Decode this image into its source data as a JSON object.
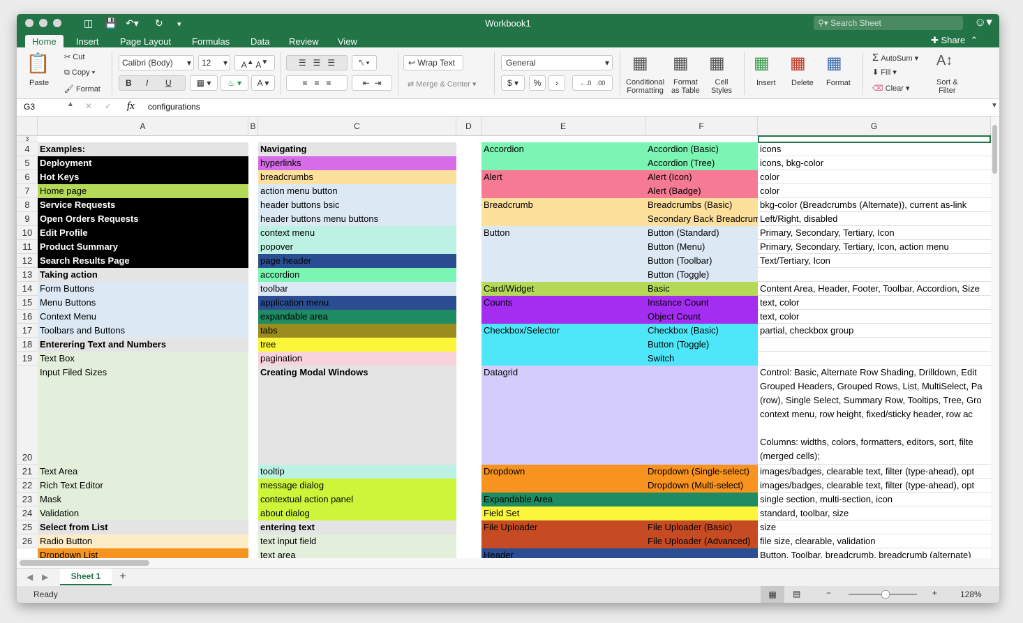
{
  "window": {
    "title": "Workbook1",
    "search_placeholder": "Search Sheet",
    "share_label": "Share"
  },
  "tabs": [
    "Home",
    "Insert",
    "Page Layout",
    "Formulas",
    "Data",
    "Review",
    "View"
  ],
  "ribbon": {
    "paste": "Paste",
    "cut": "Cut",
    "copy": "Copy",
    "format_painter": "Format",
    "font_name": "Calibri (Body)",
    "font_size": "12",
    "bold": "B",
    "italic": "I",
    "underline": "U",
    "wrap_text": "Wrap Text",
    "merge_center": "Merge & Center",
    "number_format": "General",
    "currency": "$",
    "percent": "%",
    "comma": "›",
    "increase_decimal": "←.0\n.00",
    "decrease_decimal": ".00\n→.0",
    "conditional_formatting": "Conditional\nFormatting",
    "format_as_table": "Format\nas Table",
    "cell_styles": "Cell\nStyles",
    "insert": "Insert",
    "delete": "Delete",
    "format": "Format",
    "autosum": "AutoSum",
    "fill": "Fill",
    "clear": "Clear",
    "sort_filter": "Sort &\nFilter"
  },
  "formula_bar": {
    "cell_ref": "G3",
    "fx": "fx",
    "content": "configurations"
  },
  "column_headers": [
    "A",
    "B",
    "C",
    "D",
    "E",
    "F",
    "G"
  ],
  "row_headers": [
    "3",
    "4",
    "5",
    "6",
    "7",
    "8",
    "9",
    "10",
    "11",
    "12",
    "13",
    "14",
    "15",
    "16",
    "17",
    "18",
    "19",
    "20",
    "21",
    "22",
    "23",
    "24",
    "25",
    "26"
  ],
  "cells": {
    "A": [
      {
        "row": 4,
        "text": "Examples:",
        "bold": true,
        "bg": "#e4e4e4"
      },
      {
        "row": 5,
        "text": "Deployment",
        "bold": true,
        "bg": "#000000",
        "color": "#ffffff"
      },
      {
        "row": 6,
        "text": "Hot Keys",
        "bold": true,
        "bg": "#000000",
        "color": "#ffffff"
      },
      {
        "row": 7,
        "text": "Home page",
        "bg": "#b3d957"
      },
      {
        "row": 8,
        "text": "Service Requests",
        "bold": true,
        "bg": "#000000",
        "color": "#ffffff"
      },
      {
        "row": 9,
        "text": "Open Orders Requests",
        "bold": true,
        "bg": "#000000",
        "color": "#ffffff"
      },
      {
        "row": 10,
        "text": "Edit Profile",
        "bold": true,
        "bg": "#000000",
        "color": "#ffffff"
      },
      {
        "row": 11,
        "text": "Product Summary",
        "bold": true,
        "bg": "#000000",
        "color": "#ffffff"
      },
      {
        "row": 12,
        "text": "Search Results Page",
        "bold": true,
        "bg": "#000000",
        "color": "#ffffff"
      },
      {
        "row": 13,
        "text": "Taking action",
        "bold": true,
        "bg": "#e4e4e4"
      },
      {
        "row": 14,
        "text": "Form Buttons",
        "bg": "#dce9f5"
      },
      {
        "row": 15,
        "text": "Menu Buttons",
        "bg": "#dce9f5"
      },
      {
        "row": 16,
        "text": "Context Menu",
        "bg": "#dce9f5"
      },
      {
        "row": 17,
        "text": "Toolbars and Buttons",
        "bg": "#dce9f5"
      },
      {
        "row": 18,
        "text": "Enterering Text and Numbers",
        "bold": true,
        "bg": "#e4e4e4"
      },
      {
        "row": 19,
        "text": "Text Box",
        "bg": "#e3efdb"
      },
      {
        "row": 20,
        "text": "Input Filed Sizes",
        "bg": "#e3efdb"
      },
      {
        "row": 21,
        "text": "Text Area",
        "bg": "#e3efdb"
      },
      {
        "row": 22,
        "text": "Rich Text Editor",
        "bg": "#e3efdb"
      },
      {
        "row": 23,
        "text": "Mask",
        "bg": "#e3efdb"
      },
      {
        "row": 24,
        "text": "Validation",
        "bg": "#e3efdb"
      },
      {
        "row": 25,
        "text": "Select from List",
        "bold": true,
        "bg": "#e4e4e4"
      },
      {
        "row": 26,
        "text": "Radio Button",
        "bg": "#fdecc8"
      },
      {
        "row": 27,
        "text": "Dropdown List",
        "bg": "#f7931e"
      }
    ],
    "C": [
      {
        "row": 4,
        "text": "Navigating",
        "bold": true,
        "bg": "#e4e4e4"
      },
      {
        "row": 5,
        "text": "hyperlinks",
        "bg": "#d76ce8"
      },
      {
        "row": 6,
        "text": "breadcrumbs",
        "bg": "#fde09c"
      },
      {
        "row": 7,
        "text": "action menu button",
        "bg": "#dce9f5"
      },
      {
        "row": 8,
        "text": "header buttons bsic",
        "bg": "#dce9f5"
      },
      {
        "row": 9,
        "text": "header buttons menu buttons",
        "bg": "#dce9f5"
      },
      {
        "row": 10,
        "text": "context menu",
        "bg": "#bdf1e4"
      },
      {
        "row": 11,
        "text": "popover",
        "bg": "#bdf1e4"
      },
      {
        "row": 12,
        "text": "page header",
        "bg": "#2b4e93"
      },
      {
        "row": 13,
        "text": "accordion",
        "bg": "#7bf5b3"
      },
      {
        "row": 14,
        "text": "toolbar",
        "bg": "#dce9f5"
      },
      {
        "row": 15,
        "text": "application menu",
        "bg": "#2b4e93"
      },
      {
        "row": 16,
        "text": "expandable area",
        "bg": "#1e8b62"
      },
      {
        "row": 17,
        "text": "tabs",
        "bg": "#9a8c1e"
      },
      {
        "row": 18,
        "text": "tree",
        "bg": "#fbf63a"
      },
      {
        "row": 19,
        "text": "pagination",
        "bg": "#f9d3dc"
      },
      {
        "row": 20,
        "text": "Creating Modal Windows",
        "bold": true,
        "bg": "#e4e4e4"
      },
      {
        "row": 21,
        "text": "tooltip",
        "bg": "#bdf1e4"
      },
      {
        "row": 22,
        "text": "message dialog",
        "bg": "#cdf53a"
      },
      {
        "row": 23,
        "text": "contextual action panel",
        "bg": "#cdf53a"
      },
      {
        "row": 24,
        "text": "about dialog",
        "bg": "#cdf53a"
      },
      {
        "row": 25,
        "text": "entering text",
        "bold": true,
        "bg": "#e4e4e4"
      },
      {
        "row": 26,
        "text": "text input field",
        "bg": "#e3efdb"
      },
      {
        "row": 27,
        "text": "text area",
        "bg": "#e3efdb"
      }
    ],
    "E": [
      {
        "row": 4,
        "text": "Accordion",
        "bg": "#7bf5b3",
        "span": 2
      },
      {
        "row": 6,
        "text": "Alert",
        "bg": "#f67a93",
        "span": 2
      },
      {
        "row": 8,
        "text": "Breadcrumb",
        "bg": "#fde09c",
        "span": 2
      },
      {
        "row": 10,
        "text": "Button",
        "bg": "#dce9f5",
        "span": 4
      },
      {
        "row": 14,
        "text": "Card/Widget",
        "bg": "#b3d957",
        "span": 1
      },
      {
        "row": 15,
        "text": "Counts",
        "bg": "#a42df2",
        "span": 2
      },
      {
        "row": 17,
        "text": "Checkbox/Selector",
        "bg": "#4ee7f9",
        "span": 3
      },
      {
        "row": 20,
        "text": "Datagrid",
        "bg": "#d4ccfb",
        "span": 1
      },
      {
        "row": 21,
        "text": "Dropdown",
        "bg": "#f7931e",
        "span": 2
      },
      {
        "row": 23,
        "text": "Expandable Area",
        "bg": "#1e8b62",
        "span": 1
      },
      {
        "row": 24,
        "text": "Field Set",
        "bg": "#fbf63a",
        "span": 1
      },
      {
        "row": 25,
        "text": "File Uploader",
        "bg": "#c74b22",
        "span": 2
      },
      {
        "row": 27,
        "text": "Header",
        "bg": "#2b4e93",
        "span": 1
      }
    ],
    "F": [
      {
        "row": 4,
        "text": "Accordion (Basic)",
        "bg": "#7bf5b3"
      },
      {
        "row": 5,
        "text": "Accordion (Tree)",
        "bg": "#7bf5b3"
      },
      {
        "row": 6,
        "text": "Alert (Icon)",
        "bg": "#f67a93"
      },
      {
        "row": 7,
        "text": "Alert (Badge)",
        "bg": "#f67a93"
      },
      {
        "row": 8,
        "text": "Breadcrumbs (Basic)",
        "bg": "#fde09c"
      },
      {
        "row": 9,
        "text": "Secondary Back Breadcrumb",
        "bg": "#fde09c"
      },
      {
        "row": 10,
        "text": "Button (Standard)",
        "bg": "#dce9f5"
      },
      {
        "row": 11,
        "text": "Button (Menu)",
        "bg": "#dce9f5"
      },
      {
        "row": 12,
        "text": "Button (Toolbar)",
        "bg": "#dce9f5"
      },
      {
        "row": 13,
        "text": "Button (Toggle)",
        "bg": "#dce9f5"
      },
      {
        "row": 14,
        "text": "Basic",
        "bg": "#b3d957"
      },
      {
        "row": 15,
        "text": "Instance Count",
        "bg": "#a42df2"
      },
      {
        "row": 16,
        "text": "Object Count",
        "bg": "#a42df2"
      },
      {
        "row": 17,
        "text": "Checkbox (Basic)",
        "bg": "#4ee7f9"
      },
      {
        "row": 18,
        "text": "Button (Toggle)",
        "bg": "#4ee7f9"
      },
      {
        "row": 19,
        "text": "Switch",
        "bg": "#4ee7f9"
      },
      {
        "row": 20,
        "text": "",
        "bg": "#d4ccfb"
      },
      {
        "row": 21,
        "text": "Dropdown (Single-select)",
        "bg": "#f7931e"
      },
      {
        "row": 22,
        "text": "Dropdown (Multi-select)",
        "bg": "#f7931e"
      },
      {
        "row": 23,
        "text": "",
        "bg": "#1e8b62"
      },
      {
        "row": 24,
        "text": "",
        "bg": "#fbf63a"
      },
      {
        "row": 25,
        "text": "File Uploader (Basic)",
        "bg": "#c74b22"
      },
      {
        "row": 26,
        "text": "File Uploader (Advanced)",
        "bg": "#c74b22"
      },
      {
        "row": 27,
        "text": "",
        "bg": "#2b4e93"
      }
    ],
    "G": [
      {
        "row": 4,
        "text": "icons"
      },
      {
        "row": 5,
        "text": "icons, bkg-color"
      },
      {
        "row": 6,
        "text": "color"
      },
      {
        "row": 7,
        "text": "color"
      },
      {
        "row": 8,
        "text": "bkg-color (Breadcrumbs (Alternate)), current as-link"
      },
      {
        "row": 9,
        "text": "Left/Right, disabled"
      },
      {
        "row": 10,
        "text": "Primary, Secondary, Tertiary, Icon"
      },
      {
        "row": 11,
        "text": "Primary, Secondary, Tertiary, Icon, action menu"
      },
      {
        "row": 12,
        "text": "Text/Tertiary, Icon"
      },
      {
        "row": 13,
        "text": ""
      },
      {
        "row": 14,
        "text": "Content Area, Header, Footer, Toolbar, Accordion, Size"
      },
      {
        "row": 15,
        "text": "text, color"
      },
      {
        "row": 16,
        "text": "text, color"
      },
      {
        "row": 17,
        "text": "partial, checkbox group"
      },
      {
        "row": 18,
        "text": ""
      },
      {
        "row": 19,
        "text": ""
      },
      {
        "row": 20,
        "lines": [
          "Control: Basic, Alternate Row Shading, Drilldown, Edit",
          "Grouped Headers, Grouped Rows, List, MultiSelect, Pa",
          "(row), Single Select, Summary Row, Tooltips, Tree, Gro",
          "context menu, row height, fixed/sticky header, row ac",
          "",
          "Columns: widths, colors, formatters, editors, sort, filte",
          "(merged cells);"
        ]
      },
      {
        "row": 21,
        "text": "images/badges, clearable text, filter (type-ahead), opt"
      },
      {
        "row": 22,
        "text": "images/badges, clearable text, filter (type-ahead), opt"
      },
      {
        "row": 23,
        "text": "single section, multi-section, icon"
      },
      {
        "row": 24,
        "text": "standard, toolbar, size"
      },
      {
        "row": 25,
        "text": "size"
      },
      {
        "row": 26,
        "text": "file size, clearable, validation"
      },
      {
        "row": 27,
        "text": "Button, Toolbar, breadcrumb, breadcrumb (alternate)"
      }
    ]
  },
  "sheet_tabs": [
    "Sheet 1"
  ],
  "status": {
    "text": "Ready",
    "zoom": "128%"
  },
  "colors": {
    "accent": "#227447"
  }
}
